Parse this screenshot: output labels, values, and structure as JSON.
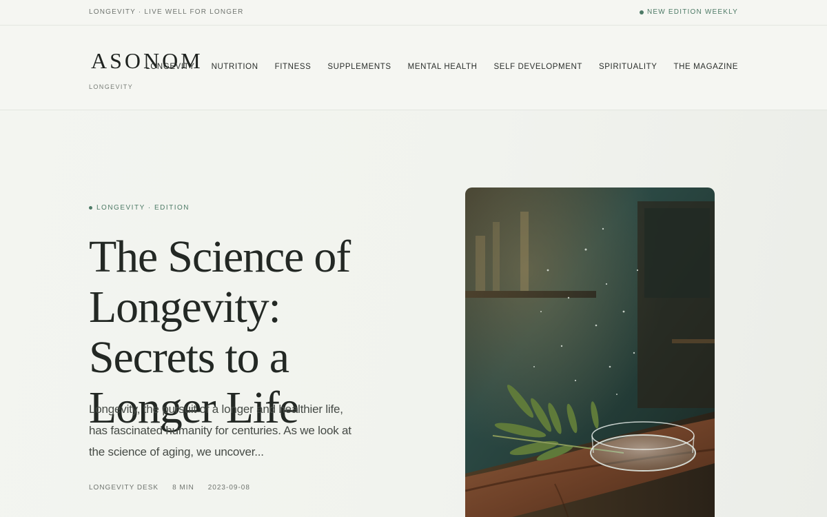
{
  "topbar": {
    "tagline": "LONGEVITY · LIVE WELL FOR LONGER",
    "edition": "NEW EDITION WEEKLY"
  },
  "header": {
    "logo": "ASONOM",
    "logo_sub": "LONGEVITY",
    "nav": [
      {
        "label": "LONGEVITY"
      },
      {
        "label": "NUTRITION"
      },
      {
        "label": "FITNESS"
      },
      {
        "label": "SUPPLEMENTS"
      },
      {
        "label": "MENTAL HEALTH"
      },
      {
        "label": "SELF DEVELOPMENT"
      },
      {
        "label": "SPIRITUALITY"
      },
      {
        "label": "THE MAGAZINE"
      }
    ]
  },
  "hero": {
    "kicker": "LONGEVITY · EDITION",
    "headline": "The Science of Longevity: Secrets to a Longer Life",
    "excerpt": "Longevity, the pursuit of a longer and healthier life, has fascinated humanity for centuries. As we look at the science of aging, we uncover...",
    "meta": {
      "author": "LONGEVITY DESK",
      "read_time": "8 MIN",
      "date": "2023-09-08"
    },
    "image_icon": "photo-olive-branch-glass-dish"
  },
  "colors": {
    "accent": "#4d7a66",
    "background": "#f3f5f0",
    "text": "#222623"
  }
}
